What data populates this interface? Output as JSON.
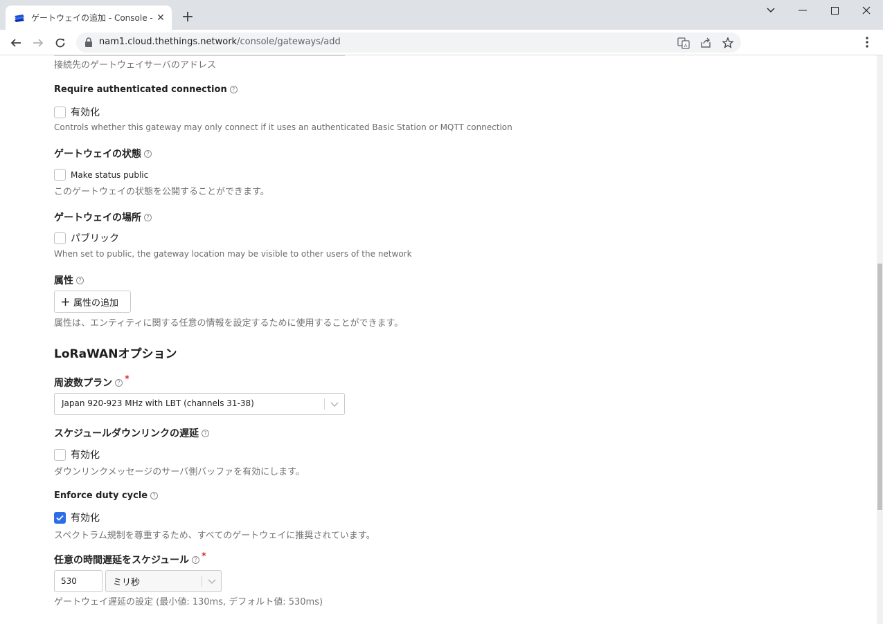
{
  "browser": {
    "tab_title": "ゲートウェイの追加 - Console - The Things",
    "url_host": "nam1.cloud.thethings.network",
    "url_path": "/console/gateways/add"
  },
  "form": {
    "prev_field_hint": "接続先のゲートウェイサーバのアドレス",
    "require_auth": {
      "label": "Require authenticated connection",
      "checkbox_label": "有効化",
      "checked": false,
      "hint": "Controls whether this gateway may only connect if it uses an authenticated Basic Station or MQTT connection"
    },
    "status": {
      "label": "ゲートウェイの状態",
      "checkbox_label": "Make status public",
      "checked": false,
      "hint": "このゲートウェイの状態を公開することができます。"
    },
    "location": {
      "label": "ゲートウェイの場所",
      "checkbox_label": "パブリック",
      "checked": false,
      "hint": "When set to public, the gateway location may be visible to other users of the network"
    },
    "attributes": {
      "label": "属性",
      "add_button": "属性の追加",
      "hint": "属性は、エンティティに関する任意の情報を設定するために使用することができます。"
    },
    "lorawan_section_title": "LoRaWANオプション",
    "frequency_plan": {
      "label": "周波数プラン",
      "required_mark": "*",
      "value": "Japan 920-923 MHz with LBT (channels 31-38)"
    },
    "schedule_downlink_late": {
      "label": "スケジュールダウンリンクの遅延",
      "checkbox_label": "有効化",
      "checked": false,
      "hint": "ダウンリンクメッセージのサーバ側バッファを有効にします。"
    },
    "duty_cycle": {
      "label": "Enforce duty cycle",
      "checkbox_label": "有効化",
      "checked": true,
      "hint": "スペクトラム規制を尊重するため、すべてのゲートウェイに推奨されています。"
    },
    "schedule_anytime_delay": {
      "label": "任意の時間遅延をスケジュール",
      "required_mark": "*",
      "value": "530",
      "unit": "ミリ秒",
      "hint": "ゲートウェイ遅延の設定 (最小値: 130ms, デフォルト値: 530ms)"
    }
  },
  "colors": {
    "accent": "#2d6de8",
    "required": "#db2828"
  }
}
